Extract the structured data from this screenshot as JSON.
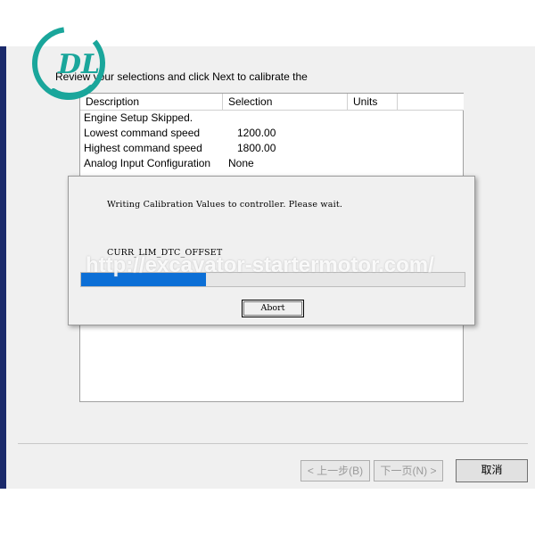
{
  "wizard": {
    "instructions": "Review your selections and click Next to calibrate the",
    "columns": [
      "Description",
      "Selection",
      "Units"
    ],
    "rows": [
      {
        "description": "Engine Setup Skipped.",
        "selection": ""
      },
      {
        "description": "Lowest command speed",
        "selection": "1200.00"
      },
      {
        "description": "Highest command speed",
        "selection": "1800.00"
      },
      {
        "description": "Analog Input Configuration",
        "selection": "None"
      }
    ],
    "buttons": {
      "back": "< 上一步(B)",
      "next": "下一页(N) >",
      "cancel": "取消"
    }
  },
  "dialog": {
    "message": "Writing Calibration Values to controller. Please wait.",
    "current_item": "CURR_LIM_DTC_OFFSET",
    "progress": 0.325,
    "abort_label": "Abort"
  },
  "watermark": {
    "text": "http://excavator-startermotor.com/",
    "logo_letters": "DL"
  },
  "colors": {
    "accent_blue": "#0c6fd6",
    "stripe_navy": "#1b2a6b",
    "logo_teal": "#1aa69b"
  }
}
